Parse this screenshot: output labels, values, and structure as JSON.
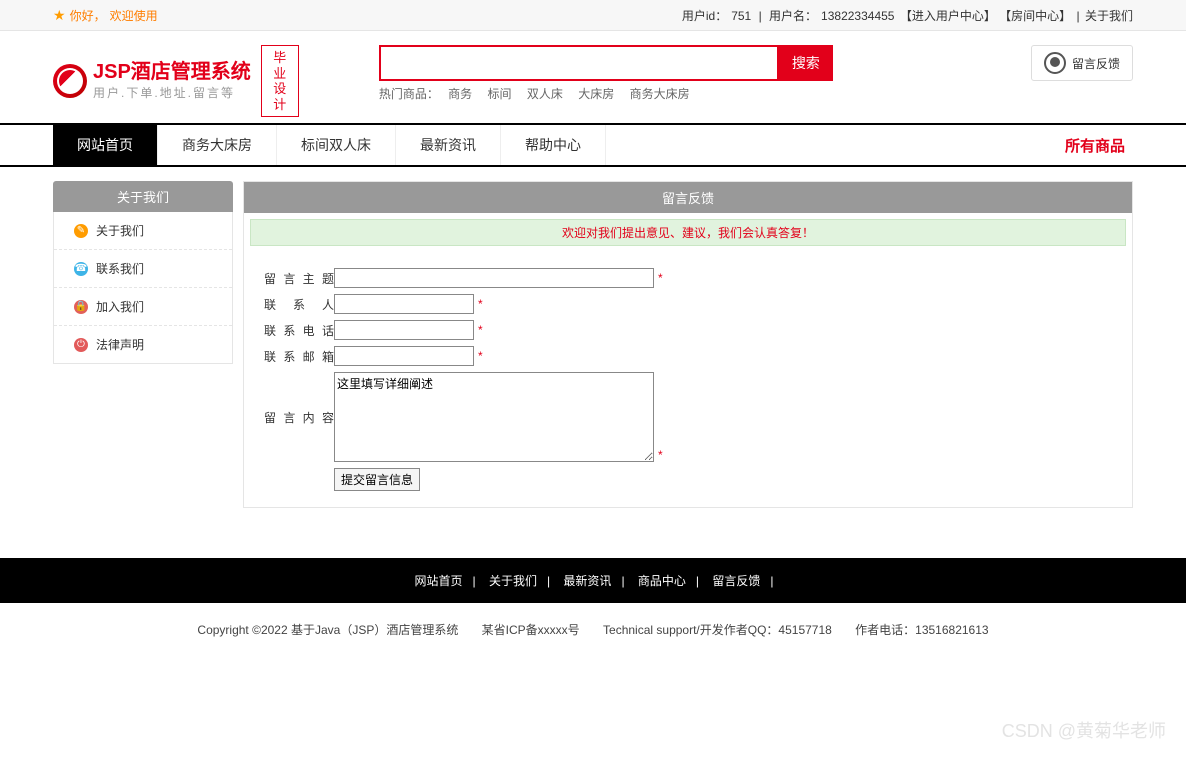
{
  "topbar": {
    "greeting_prefix": "你好，",
    "greeting": "欢迎使用",
    "user_id_label": "用户id：",
    "user_id": "751",
    "sep": " | ",
    "username_label": "用户名：",
    "username": "13822334455",
    "user_center": "【进入用户中心】",
    "room_center": "【房间中心】",
    "about": "关于我们"
  },
  "logo": {
    "title": "JSP酒店管理系统",
    "subtitle": "用户.下单.地址.留言等",
    "badge_l1": "毕业",
    "badge_l2": "设计"
  },
  "search": {
    "button": "搜索",
    "hot_label": "热门商品：",
    "hot": [
      "商务",
      "标间",
      "双人床",
      "大床房",
      "商务大床房"
    ]
  },
  "feedback_btn": "留言反馈",
  "nav": {
    "items": [
      "网站首页",
      "商务大床房",
      "标间双人床",
      "最新资讯",
      "帮助中心"
    ],
    "all": "所有商品"
  },
  "sidebar": {
    "title": "关于我们",
    "items": [
      "关于我们",
      "联系我们",
      "加入我们",
      "法律声明"
    ]
  },
  "panel": {
    "title": "留言反馈",
    "notice": "欢迎对我们提出意见、建议，我们会认真答复！",
    "labels": {
      "subject": "留言主题",
      "contact": "联 系 人",
      "phone": "联系电话",
      "email": "联系邮箱",
      "content": "留言内容"
    },
    "textarea_value": "这里填写详细阐述",
    "submit": "提交留言信息",
    "star": "*"
  },
  "footer_nav": [
    "网站首页",
    "关于我们",
    "最新资讯",
    "商品中心",
    "留言反馈"
  ],
  "footer_sep": "|",
  "copyright": {
    "c1": "Copyright ©2022 基于Java（JSP）酒店管理系统",
    "c2": "某省ICP备xxxxx号",
    "c3": "Technical support/开发作者QQ：45157718",
    "c4": "作者电话：13516821613"
  },
  "watermark": "CSDN @黄菊华老师"
}
